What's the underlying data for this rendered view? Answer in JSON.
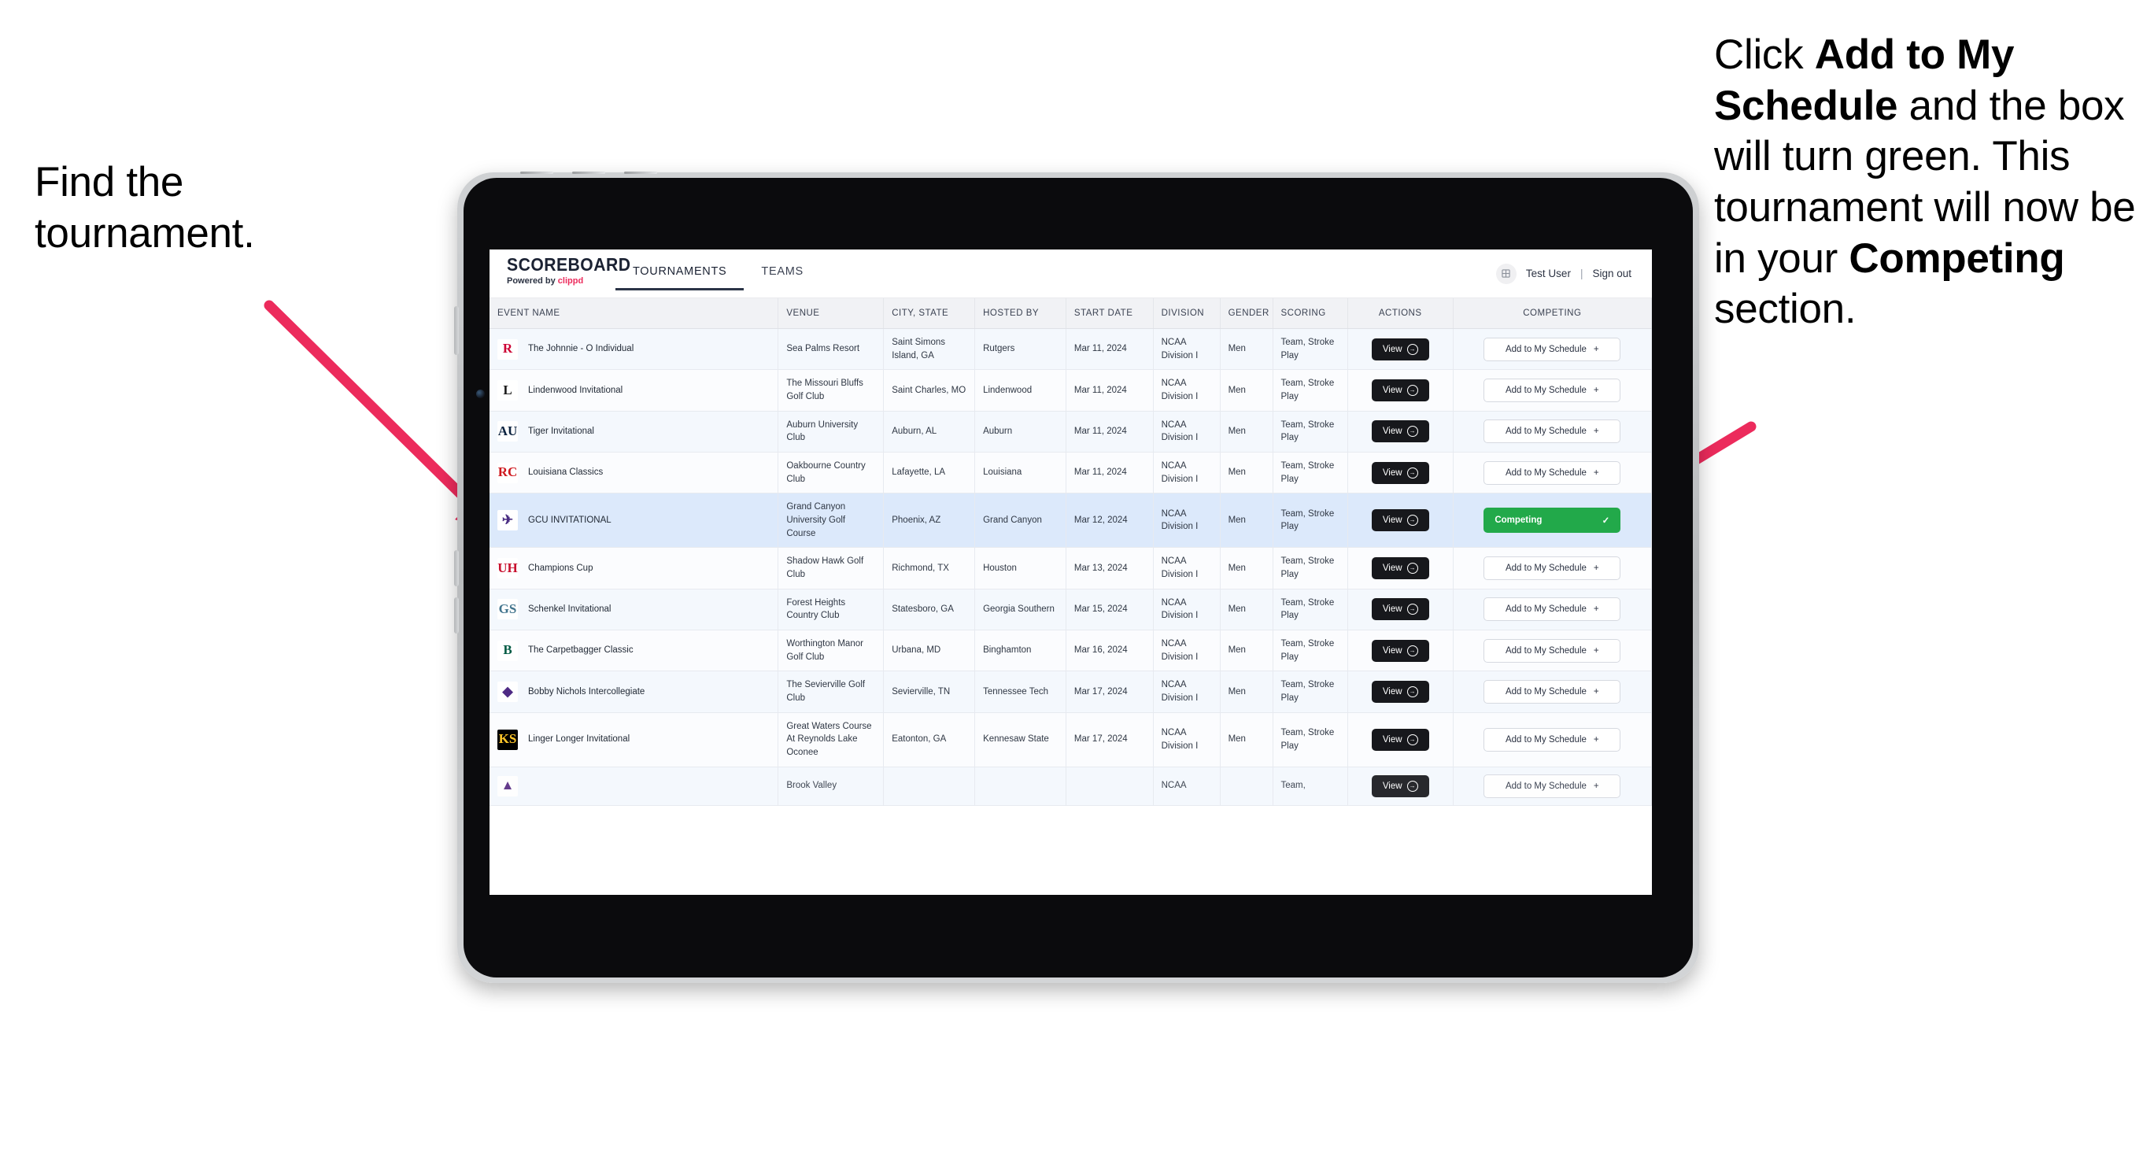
{
  "annotations": {
    "left": {
      "line1": "Find the",
      "line2": "tournament."
    },
    "right": {
      "seg1": "Click ",
      "bold1": "Add to My Schedule",
      "seg2": " and the box will turn green. This tournament will now be in your ",
      "bold2": "Competing",
      "seg3": " section."
    },
    "arrow_color": "#ec2b5c"
  },
  "app": {
    "brand": {
      "title": "SCOREBOARD",
      "powered_prefix": "Powered by ",
      "powered_brand": "clippd"
    },
    "nav": [
      {
        "label": "TOURNAMENTS",
        "active": true
      },
      {
        "label": "TEAMS",
        "active": false
      }
    ],
    "header_right": {
      "grid_icon": "grid-icon",
      "user": "Test User",
      "separator": "|",
      "signout": "Sign out"
    },
    "table": {
      "columns": [
        "EVENT NAME",
        "VENUE",
        "CITY, STATE",
        "HOSTED BY",
        "START DATE",
        "DIVISION",
        "GENDER",
        "SCORING",
        "ACTIONS",
        "COMPETING"
      ],
      "buttons": {
        "view": "View",
        "add": "Add to My Schedule",
        "add_plus": "+",
        "competing": "Competing",
        "competing_check": "✓"
      },
      "rows": [
        {
          "logo_text": "R",
          "logo_fg": "#cc0033",
          "logo_bg": "#ffffff",
          "event": "The Johnnie - O Individual",
          "venue": "Sea Palms Resort",
          "city": "Saint Simons Island, GA",
          "host": "Rutgers",
          "date": "Mar 11, 2024",
          "division": "NCAA Division I",
          "gender": "Men",
          "scoring": "Team, Stroke Play",
          "competing": false
        },
        {
          "logo_text": "L",
          "logo_fg": "#1a1a1a",
          "logo_bg": "#ffffff",
          "event": "Lindenwood Invitational",
          "venue": "The Missouri Bluffs Golf Club",
          "city": "Saint Charles, MO",
          "host": "Lindenwood",
          "date": "Mar 11, 2024",
          "division": "NCAA Division I",
          "gender": "Men",
          "scoring": "Team, Stroke Play",
          "competing": false
        },
        {
          "logo_text": "AU",
          "logo_fg": "#0c2340",
          "logo_bg": "#ffffff",
          "event": "Tiger Invitational",
          "venue": "Auburn University Club",
          "city": "Auburn, AL",
          "host": "Auburn",
          "date": "Mar 11, 2024",
          "division": "NCAA Division I",
          "gender": "Men",
          "scoring": "Team, Stroke Play",
          "competing": false
        },
        {
          "logo_text": "RC",
          "logo_fg": "#ce181e",
          "logo_bg": "#ffffff",
          "event": "Louisiana Classics",
          "venue": "Oakbourne Country Club",
          "city": "Lafayette, LA",
          "host": "Louisiana",
          "date": "Mar 11, 2024",
          "division": "NCAA Division I",
          "gender": "Men",
          "scoring": "Team, Stroke Play",
          "competing": false
        },
        {
          "logo_text": "✈",
          "logo_fg": "#4b2e83",
          "logo_bg": "#ffffff",
          "event": "GCU INVITATIONAL",
          "venue": "Grand Canyon University Golf Course",
          "city": "Phoenix, AZ",
          "host": "Grand Canyon",
          "date": "Mar 12, 2024",
          "division": "NCAA Division I",
          "gender": "Men",
          "scoring": "Team, Stroke Play",
          "competing": true,
          "highlight": true
        },
        {
          "logo_text": "UH",
          "logo_fg": "#c8102e",
          "logo_bg": "#ffffff",
          "event": "Champions Cup",
          "venue": "Shadow Hawk Golf Club",
          "city": "Richmond, TX",
          "host": "Houston",
          "date": "Mar 13, 2024",
          "division": "NCAA Division I",
          "gender": "Men",
          "scoring": "Team, Stroke Play",
          "competing": false
        },
        {
          "logo_text": "GS",
          "logo_fg": "#41748d",
          "logo_bg": "#ffffff",
          "event": "Schenkel Invitational",
          "venue": "Forest Heights Country Club",
          "city": "Statesboro, GA",
          "host": "Georgia Southern",
          "date": "Mar 15, 2024",
          "division": "NCAA Division I",
          "gender": "Men",
          "scoring": "Team, Stroke Play",
          "competing": false
        },
        {
          "logo_text": "B",
          "logo_fg": "#005a43",
          "logo_bg": "#ffffff",
          "event": "The Carpetbagger Classic",
          "venue": "Worthington Manor Golf Club",
          "city": "Urbana, MD",
          "host": "Binghamton",
          "date": "Mar 16, 2024",
          "division": "NCAA Division I",
          "gender": "Men",
          "scoring": "Team, Stroke Play",
          "competing": false
        },
        {
          "logo_text": "◆",
          "logo_fg": "#4e2a84",
          "logo_bg": "#ffffff",
          "event": "Bobby Nichols Intercollegiate",
          "venue": "The Sevierville Golf Club",
          "city": "Sevierville, TN",
          "host": "Tennessee Tech",
          "date": "Mar 17, 2024",
          "division": "NCAA Division I",
          "gender": "Men",
          "scoring": "Team, Stroke Play",
          "competing": false
        },
        {
          "logo_text": "KS",
          "logo_fg": "#ffc629",
          "logo_bg": "#000000",
          "event": "Linger Longer Invitational",
          "venue": "Great Waters Course At Reynolds Lake Oconee",
          "city": "Eatonton, GA",
          "host": "Kennesaw State",
          "date": "Mar 17, 2024",
          "division": "NCAA Division I",
          "gender": "Men",
          "scoring": "Team, Stroke Play",
          "competing": false
        },
        {
          "logo_text": "▲",
          "logo_fg": "#582c83",
          "logo_bg": "#ffffff",
          "event": "",
          "venue": "Brook Valley",
          "city": "",
          "host": "",
          "date": "",
          "division": "NCAA",
          "gender": "",
          "scoring": "Team,",
          "competing": false,
          "cut": true
        }
      ]
    }
  }
}
